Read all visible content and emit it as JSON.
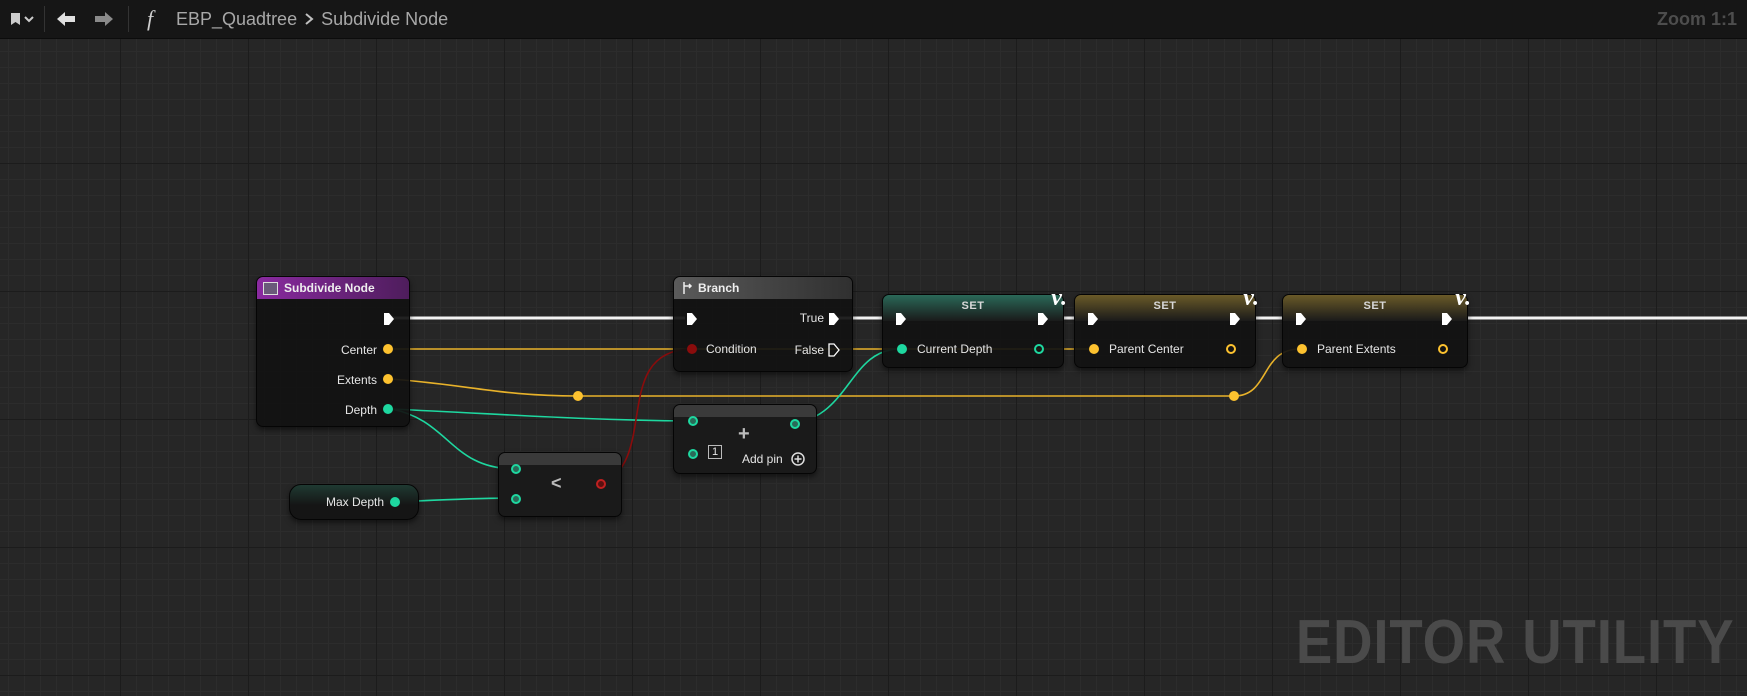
{
  "toolbar": {
    "bookmark_icon": "bookmark-icon",
    "back_icon": "arrow-left-icon",
    "forward_icon": "arrow-right-icon",
    "function_icon": "f",
    "breadcrumb": [
      "EBP_Quadtree",
      "Subdivide Node"
    ],
    "zoom": "Zoom 1:1"
  },
  "nodes": {
    "entry": {
      "title": "Subdivide Node",
      "pins": [
        "Center",
        "Extents",
        "Depth"
      ]
    },
    "max_depth": {
      "label": "Max Depth"
    },
    "less": {
      "op": "<"
    },
    "add": {
      "op": "+",
      "literal": "1",
      "add_pin": "Add pin"
    },
    "branch": {
      "title": "Branch",
      "condition": "Condition",
      "true": "True",
      "false": "False"
    },
    "set1": {
      "title": "SET",
      "var": "Current Depth"
    },
    "set2": {
      "title": "SET",
      "var": "Parent Center"
    },
    "set3": {
      "title": "SET",
      "var": "Parent Extents"
    }
  },
  "colors": {
    "exec": "#ffffff",
    "vector": "#fdc22f",
    "integer": "#1ed8a0",
    "boolean": "#8a0c0c",
    "function_header": "#7a2a8a"
  },
  "watermark": "EDITOR UTILITY"
}
